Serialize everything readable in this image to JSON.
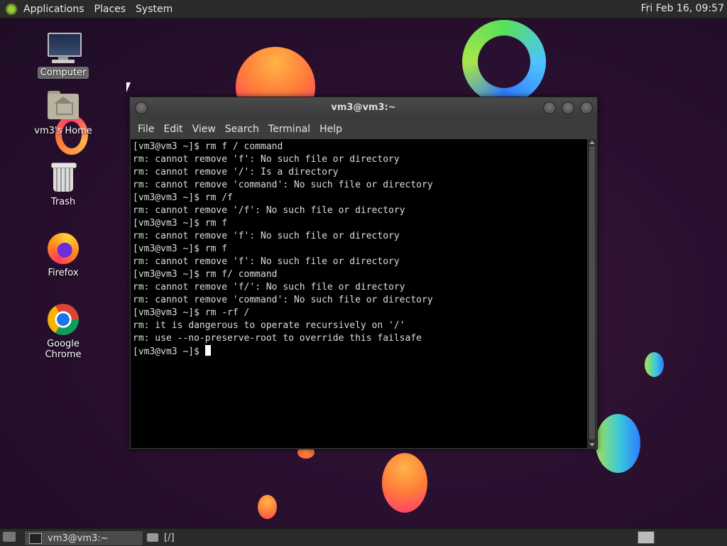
{
  "top_panel": {
    "menus": [
      "Applications",
      "Places",
      "System"
    ],
    "clock": "Fri Feb 16, 09:57"
  },
  "desktop_icons": [
    {
      "label": "Computer",
      "icon": "computer-icon"
    },
    {
      "label": "vm3's Home",
      "icon": "home-folder-icon"
    },
    {
      "label": "Trash",
      "icon": "trash-icon"
    },
    {
      "label": "Firefox",
      "icon": "firefox-icon"
    },
    {
      "label": "Google Chrome",
      "icon": "chrome-icon"
    }
  ],
  "terminal": {
    "title": "vm3@vm3:~",
    "menu": [
      "File",
      "Edit",
      "View",
      "Search",
      "Terminal",
      "Help"
    ],
    "lines": [
      "[vm3@vm3 ~]$ rm f / command",
      "rm: cannot remove 'f': No such file or directory",
      "rm: cannot remove '/': Is a directory",
      "rm: cannot remove 'command': No such file or directory",
      "[vm3@vm3 ~]$ rm /f",
      "rm: cannot remove '/f': No such file or directory",
      "[vm3@vm3 ~]$ rm f",
      "rm: cannot remove 'f': No such file or directory",
      "[vm3@vm3 ~]$ rm f",
      "rm: cannot remove 'f': No such file or directory",
      "[vm3@vm3 ~]$ rm f/ command",
      "rm: cannot remove 'f/': No such file or directory",
      "rm: cannot remove 'command': No such file or directory",
      "[vm3@vm3 ~]$ rm -rf /",
      "rm: it is dangerous to operate recursively on '/'",
      "rm: use --no-preserve-root to override this failsafe"
    ],
    "prompt": "[vm3@vm3 ~]$ "
  },
  "taskbar": {
    "tasks": [
      "vm3@vm3:~",
      "[/]"
    ]
  }
}
